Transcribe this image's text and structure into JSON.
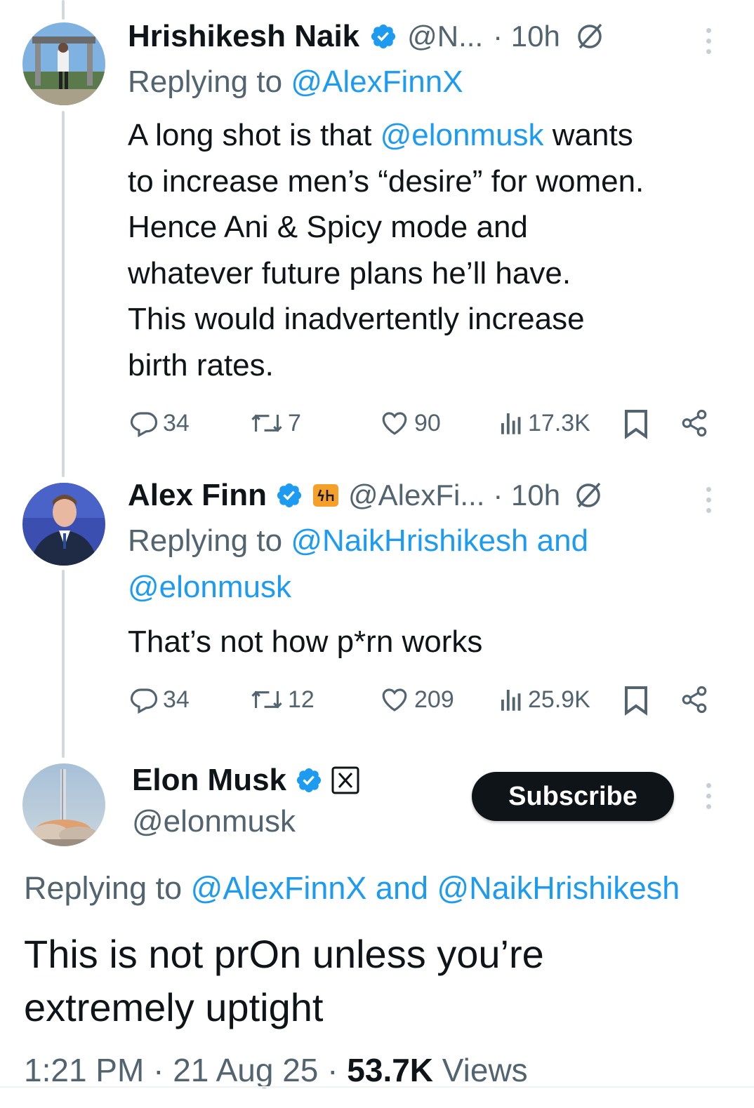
{
  "colors": {
    "accent": "#1d9bf0",
    "text": "#0f1419",
    "muted": "#536471",
    "verified": "#1d9bf0"
  },
  "tweet1": {
    "name": "Hrishikesh Naik",
    "handle": "@N...",
    "time": "· 10h",
    "replying_prefix": "Replying to ",
    "replying_to": "@AlexFinnX",
    "text_lines": [
      {
        "pre": "A long shot is that ",
        "mention": "@elonmusk",
        "post": " wants"
      },
      {
        "pre": "to increase men’s “desire” for women.",
        "mention": "",
        "post": ""
      },
      {
        "pre": "Hence Ani & Spicy mode and",
        "mention": "",
        "post": ""
      },
      {
        "pre": "whatever future plans he’ll have.",
        "mention": "",
        "post": ""
      },
      {
        "pre": "This would inadvertently increase",
        "mention": "",
        "post": ""
      },
      {
        "pre": "birth rates.",
        "mention": "",
        "post": ""
      }
    ],
    "replies": "34",
    "reposts": "7",
    "likes": "90",
    "views": "17.3K"
  },
  "tweet2": {
    "name": "Alex Finn",
    "handle": "@AlexFi...",
    "time": "· 10h",
    "replying_prefix": "Replying to ",
    "replying_to_1": "@NaikHrishikesh and",
    "replying_to_2": "@elonmusk",
    "text": "That’s not how p*rn works",
    "replies": "34",
    "reposts": "12",
    "likes": "209",
    "views": "25.9K"
  },
  "main": {
    "name": "Elon Musk",
    "handle": "@elonmusk",
    "subscribe_label": "Subscribe",
    "replying_prefix": "Replying to ",
    "replying_to": "@AlexFinnX and @NaikHrishikesh",
    "text_line1": "This is not prOn unless you’re",
    "text_line2": "extremely uptight",
    "time": "1:21 PM · 21 Aug 25 · ",
    "views_count": "53.7K",
    "views_label": " Views"
  },
  "icons": [
    "verified-badge-icon",
    "no-grok-icon",
    "more-icon",
    "reply-icon",
    "repost-icon",
    "like-icon",
    "views-icon",
    "bookmark-icon",
    "share-icon",
    "affiliate-badge-icon",
    "x-logo-badge-icon"
  ]
}
